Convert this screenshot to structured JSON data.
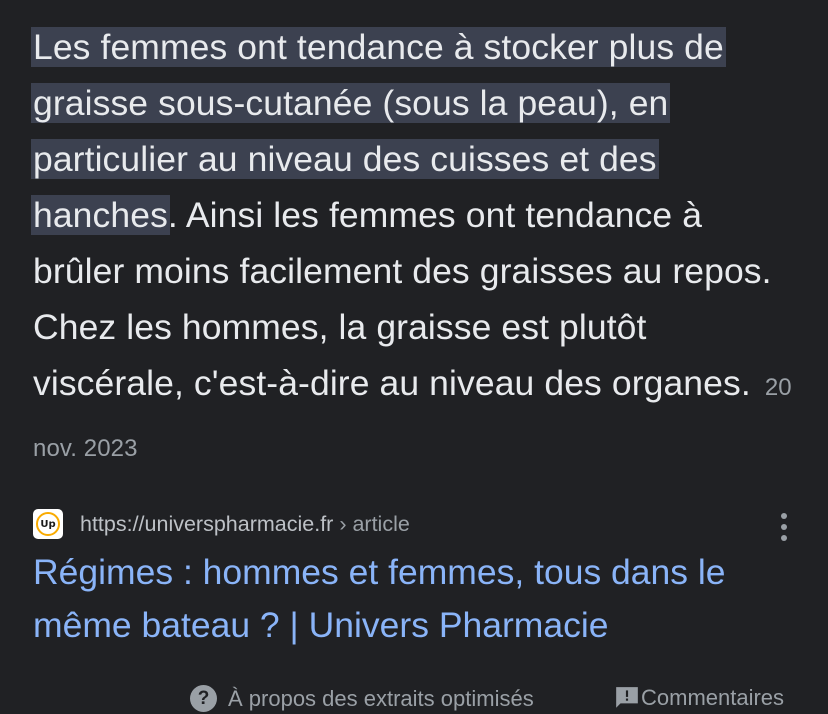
{
  "snippet": {
    "highlighted": "Les femmes ont tendance à stocker plus de graisse sous-cutanée (sous la peau), en particulier au niveau des cuisses et des hanches",
    "rest": ". Ainsi les femmes ont tendance à brûler moins facilement des graisses au repos. Chez les hommes, la graisse est plutôt viscérale, c'est-à-dire au niveau des organes.",
    "date": "20 nov. 2023"
  },
  "source": {
    "favicon_text": "Up",
    "url": "https://universpharmacie.fr",
    "breadcrumb": " › article",
    "more_icon": "three-dots-vertical-icon"
  },
  "result": {
    "title": "Régimes : hommes et femmes, tous dans le même bateau ? | Univers Pharmacie"
  },
  "footer": {
    "about_label": "À propos des extraits optimisés",
    "feedback_label": "Commentaires",
    "about_icon": "help-circle-icon",
    "feedback_icon": "feedback-icon"
  },
  "colors": {
    "background": "#202124",
    "text": "#e8eaed",
    "highlight": "#3c4150",
    "link": "#8ab4f8",
    "muted": "#9aa0a6"
  }
}
